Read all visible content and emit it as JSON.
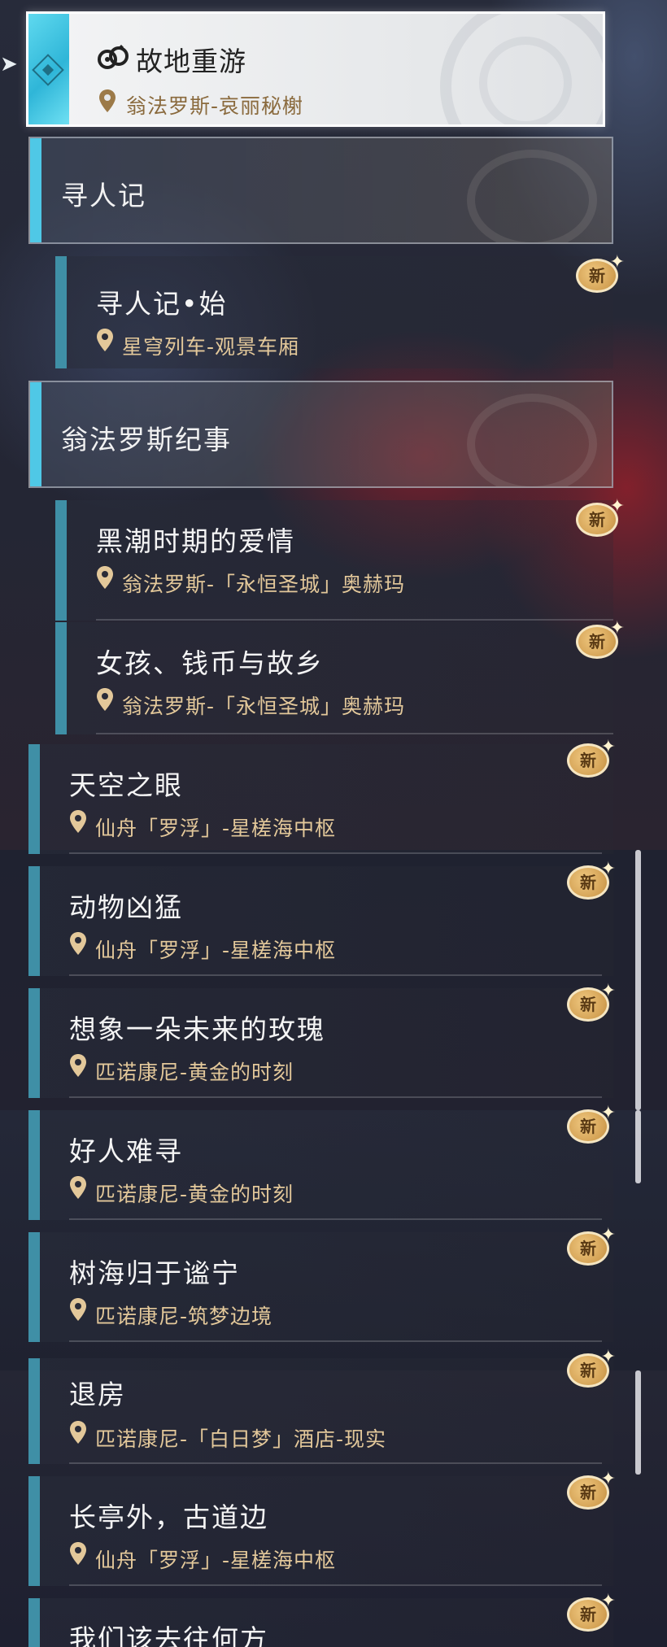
{
  "selected": {
    "title": "故地重游",
    "location": "翁法罗斯-哀丽秘榭"
  },
  "groups": [
    {
      "title": "寻人记"
    },
    {
      "title": "翁法罗斯纪事"
    }
  ],
  "badge_label": "新",
  "items": [
    {
      "title": "寻人记•始",
      "location": "星穹列车-观景车厢"
    },
    {
      "title": "黑潮时期的爱情",
      "location": "翁法罗斯-「永恒圣城」奥赫玛"
    },
    {
      "title": "女孩、钱币与故乡",
      "location": "翁法罗斯-「永恒圣城」奥赫玛"
    },
    {
      "title": "天空之眼",
      "location": "仙舟「罗浮」-星槎海中枢"
    },
    {
      "title": "动物凶猛",
      "location": "仙舟「罗浮」-星槎海中枢"
    },
    {
      "title": "想象一朵未来的玫瑰",
      "location": "匹诺康尼-黄金的时刻"
    },
    {
      "title": "好人难寻",
      "location": "匹诺康尼-黄金的时刻"
    },
    {
      "title": "树海归于谧宁",
      "location": "匹诺康尼-筑梦边境"
    },
    {
      "title": "退房",
      "location": "匹诺康尼-「白日梦」酒店-现实"
    },
    {
      "title": "长亭外，古道边",
      "location": "仙舟「罗浮」-星槎海中枢"
    },
    {
      "title": "我们该去往何方",
      "location": ""
    }
  ],
  "colors": {
    "accent_cyan": "#4fc8e6",
    "item_bar": "#3f8fa6",
    "location_gold": "#e3c89a",
    "badge_gold": "#d3a154"
  }
}
